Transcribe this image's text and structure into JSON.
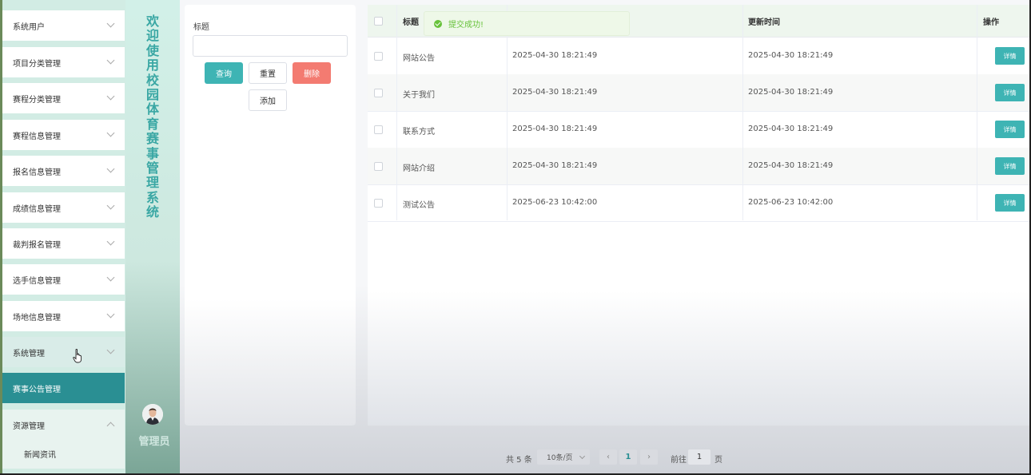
{
  "sidebar": {
    "items": [
      {
        "label": "系统用户"
      },
      {
        "label": "项目分类管理"
      },
      {
        "label": "赛程分类管理"
      },
      {
        "label": "赛程信息管理"
      },
      {
        "label": "报名信息管理"
      },
      {
        "label": "成绩信息管理"
      },
      {
        "label": "裁判报名管理"
      },
      {
        "label": "选手信息管理"
      },
      {
        "label": "场地信息管理"
      },
      {
        "label": "系统管理"
      },
      {
        "label": "赛事公告管理"
      },
      {
        "label": "资源管理"
      }
    ],
    "sub_items": [
      {
        "label": "新闻资讯"
      }
    ],
    "active": "赛事公告管理",
    "hovered": "系统管理",
    "expanded": "资源管理"
  },
  "welcome": {
    "text": "欢迎使用校园体育赛事管理系统",
    "role": "管理员"
  },
  "search": {
    "title_label": "标题",
    "title_value": "",
    "query_label": "查询",
    "reset_label": "重置",
    "delete_label": "删除",
    "add_label": "添加"
  },
  "toast": {
    "message": "提交成功!"
  },
  "table": {
    "headers": {
      "title": "标题",
      "update_time": "更新时间",
      "action": "操作"
    },
    "rows": [
      {
        "title": "网站公告",
        "create_time": "2025-04-30 18:21:49",
        "update_time": "2025-04-30 18:21:49",
        "action": "详情"
      },
      {
        "title": "关于我们",
        "create_time": "2025-04-30 18:21:49",
        "update_time": "2025-04-30 18:21:49",
        "action": "详情"
      },
      {
        "title": "联系方式",
        "create_time": "2025-04-30 18:21:49",
        "update_time": "2025-04-30 18:21:49",
        "action": "详情"
      },
      {
        "title": "网站介绍",
        "create_time": "2025-04-30 18:21:49",
        "update_time": "2025-04-30 18:21:49",
        "action": "详情"
      },
      {
        "title": "测试公告",
        "create_time": "2025-06-23 10:42:00",
        "update_time": "2025-06-23 10:42:00",
        "action": "详情"
      }
    ]
  },
  "pagination": {
    "total": "共 5 条",
    "page_size": "10条/页",
    "current_page": "1",
    "goto_label": "前往",
    "goto_value": "1",
    "page_unit": "页",
    "prev": "‹",
    "next": "›"
  },
  "colors": {
    "accent": "#3eb4b4",
    "active_menu": "#2a8f93",
    "danger": "#f37b71",
    "success": "#67c23a"
  }
}
